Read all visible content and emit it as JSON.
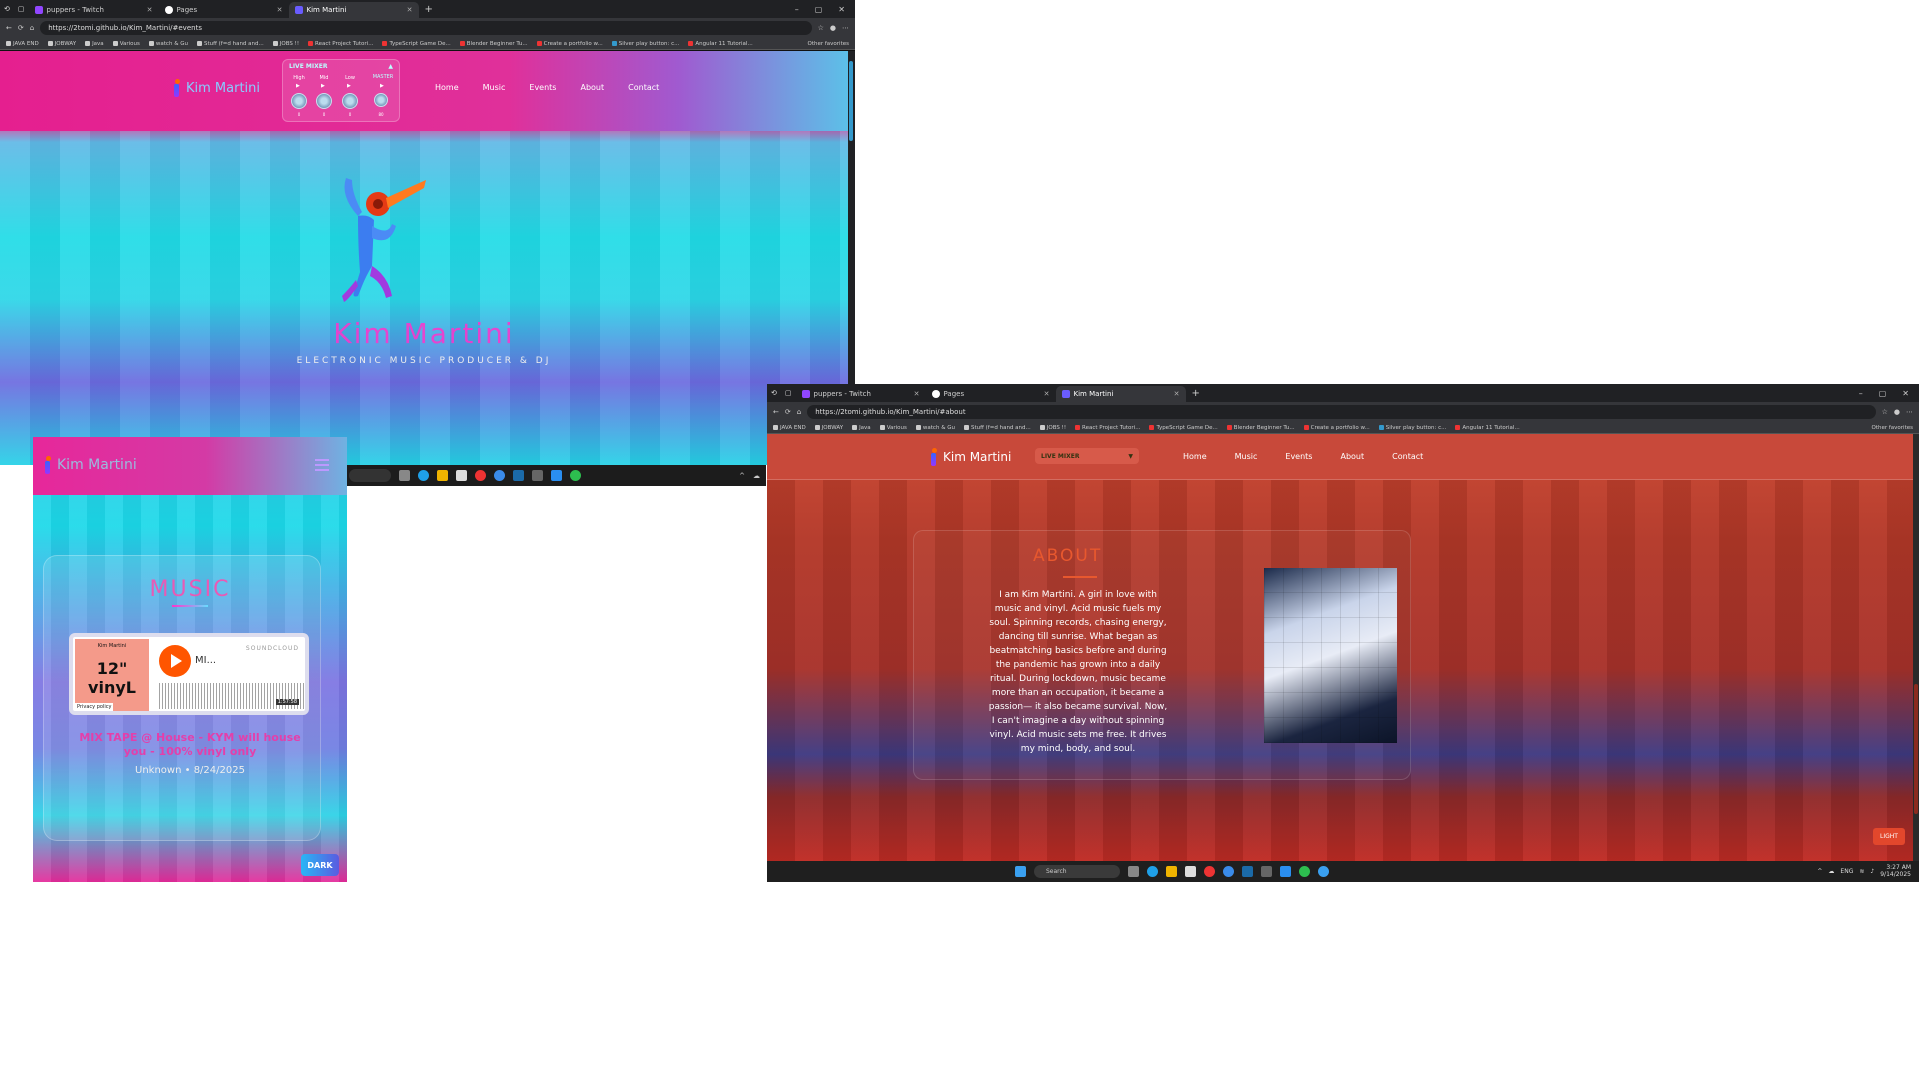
{
  "windows": {
    "desktop": {
      "tabs": [
        {
          "label": "puppers - Twitch",
          "color": "#9146ff"
        },
        {
          "label": "Pages",
          "color": "#ffffff"
        },
        {
          "label": "Kim Martini",
          "color": "#6a5cff"
        }
      ],
      "url": "https://2tomi.github.io/Kim_Martini/#events",
      "bookmarks": [
        "JAVA END",
        "JOBWAY",
        "Java",
        "Various",
        "watch & Gu",
        "Stuff (f=d hand and...",
        "JOBS !!",
        "React Project Tutori...",
        "TypeScript Game De...",
        "Blender Beginner Tu...",
        "Create a portfolio w...",
        "Silver play button: c...",
        "Angular 11 Tutorial..."
      ],
      "other_bookmarks": "Other favorites",
      "site": {
        "logo_text": "Kim Martini",
        "mixer": {
          "title": "LIVE MIXER",
          "collapse_icon": "▲",
          "channels": [
            {
              "label": "High",
              "value": "0"
            },
            {
              "label": "Mid",
              "value": "0"
            },
            {
              "label": "Low",
              "value": "0"
            }
          ],
          "master": {
            "label": "MASTER",
            "value": "80"
          },
          "play_glyph": "▶"
        },
        "nav": [
          "Home",
          "Music",
          "Events",
          "About",
          "Contact"
        ],
        "hero_title": "Kim Martini",
        "hero_subtitle": "ELECTRONIC MUSIC PRODUCER & DJ"
      }
    },
    "mobile": {
      "logo_text": "Kim Martini",
      "section_title": "MUSIC",
      "player": {
        "art_top": "Kim Martini",
        "art_main": "12\" vinyL",
        "privacy": "Privacy policy",
        "track_short": "MI...",
        "brand": "SOUNDCLOUD",
        "duration": "1:57:58"
      },
      "mix_title": "MIX TAPE @ House - KYM will house you - 100% vinyl only",
      "meta": "Unknown • 8/24/2025",
      "theme_button": "DARK"
    },
    "about_window": {
      "tabs": [
        {
          "label": "puppers - Twitch",
          "color": "#9146ff"
        },
        {
          "label": "Pages",
          "color": "#ffffff"
        },
        {
          "label": "Kim Martini",
          "color": "#6a5cff"
        }
      ],
      "url": "https://2tomi.github.io/Kim_Martini/#about",
      "bookmarks": [
        "JAVA END",
        "JOBWAY",
        "Java",
        "Various",
        "watch & Gu",
        "Stuff (f=d hand and...",
        "JOBS !!",
        "React Project Tutori...",
        "TypeScript Game De...",
        "Blender Beginner Tu...",
        "Create a portfolio w...",
        "Silver play button: c...",
        "Angular 11 Tutorial..."
      ],
      "other_bookmarks": "Other favorites",
      "site": {
        "logo_text": "Kim Martini",
        "mixer_label": "LIVE MIXER",
        "mixer_caret": "▼",
        "nav": [
          "Home",
          "Music",
          "Events",
          "About",
          "Contact"
        ],
        "about_title": "ABOUT",
        "about_text": "I am Kim Martini. A girl in love with music and vinyl. Acid music fuels my soul. Spinning records, chasing energy, dancing till sunrise. What began as beatmatching basics before and during the pandemic has grown into a daily ritual. During lockdown, music became more than an occupation, it became a passion— it also became survival. Now, I can't imagine a day without spinning vinyl. Acid music sets me free. It drives my mind, body, and soul.",
        "theme_button": "LIGHT"
      },
      "taskbar": {
        "search": "Search",
        "lang": "ENG",
        "time": "3:27 AM",
        "date": "9/14/2025"
      }
    }
  },
  "colors": {
    "pink": "#e6289b",
    "cyan": "#1fdbe6",
    "purple": "#6b6ae0",
    "red": "#c9452f"
  }
}
